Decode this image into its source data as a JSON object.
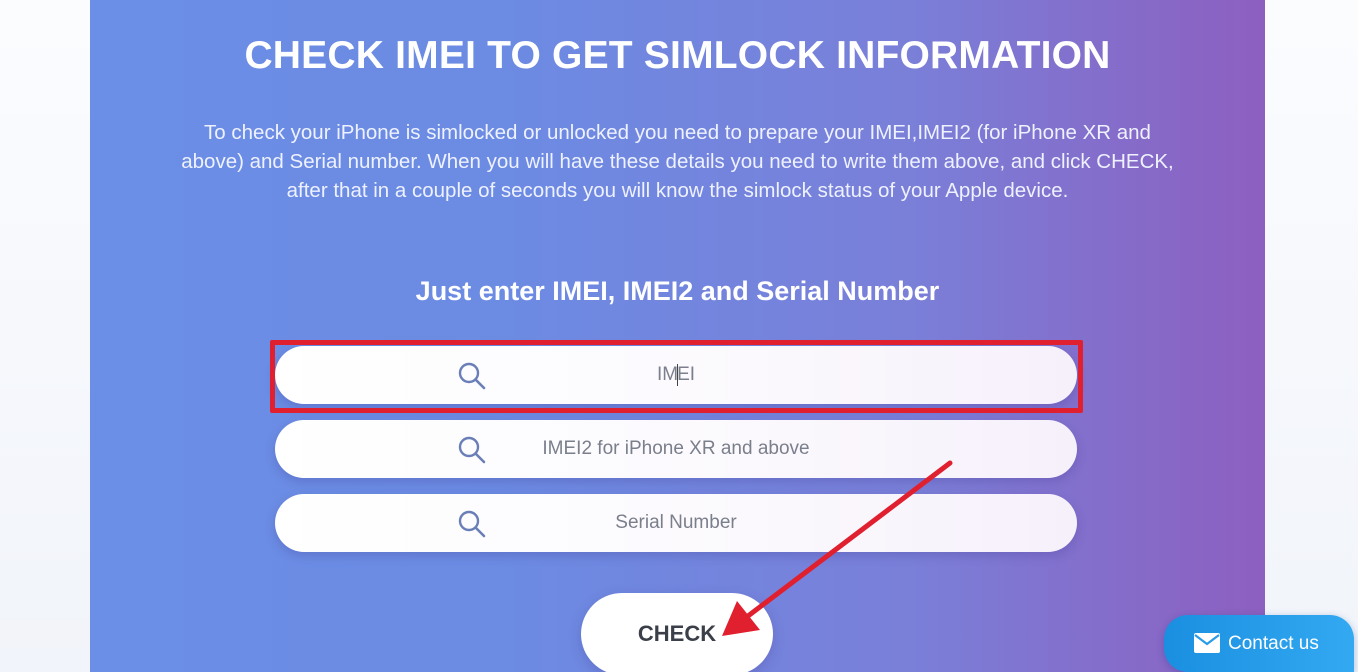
{
  "hero": {
    "title": "CHECK IMEI TO GET SIMLOCK INFORMATION",
    "description": "To check your iPhone is simlocked or unlocked you need to prepare your IMEI,IMEI2 (for iPhone XR and above) and Serial number. When you will have these details you need to write them above, and click CHECK, after that in a couple of seconds you will know the simlock status of your Apple device."
  },
  "form": {
    "heading": "Just enter IMEI, IMEI2 and Serial Number",
    "imei_placeholder_before_caret": "IM",
    "imei_placeholder_after_caret": "EI",
    "imei2_placeholder": "IMEI2 for iPhone XR and above",
    "serial_placeholder": "Serial Number",
    "check_label": "CHECK"
  },
  "contact": {
    "label": "Contact us"
  },
  "colors": {
    "gradient_start": "#6b8ee6",
    "gradient_end": "#8d5fc0",
    "annotation_red": "#e0202e",
    "contact_blue": "#1a8fe0"
  },
  "icons": {
    "field_icon": "search-icon",
    "contact_icon": "envelope-icon",
    "annotation": "arrow-annotation"
  }
}
